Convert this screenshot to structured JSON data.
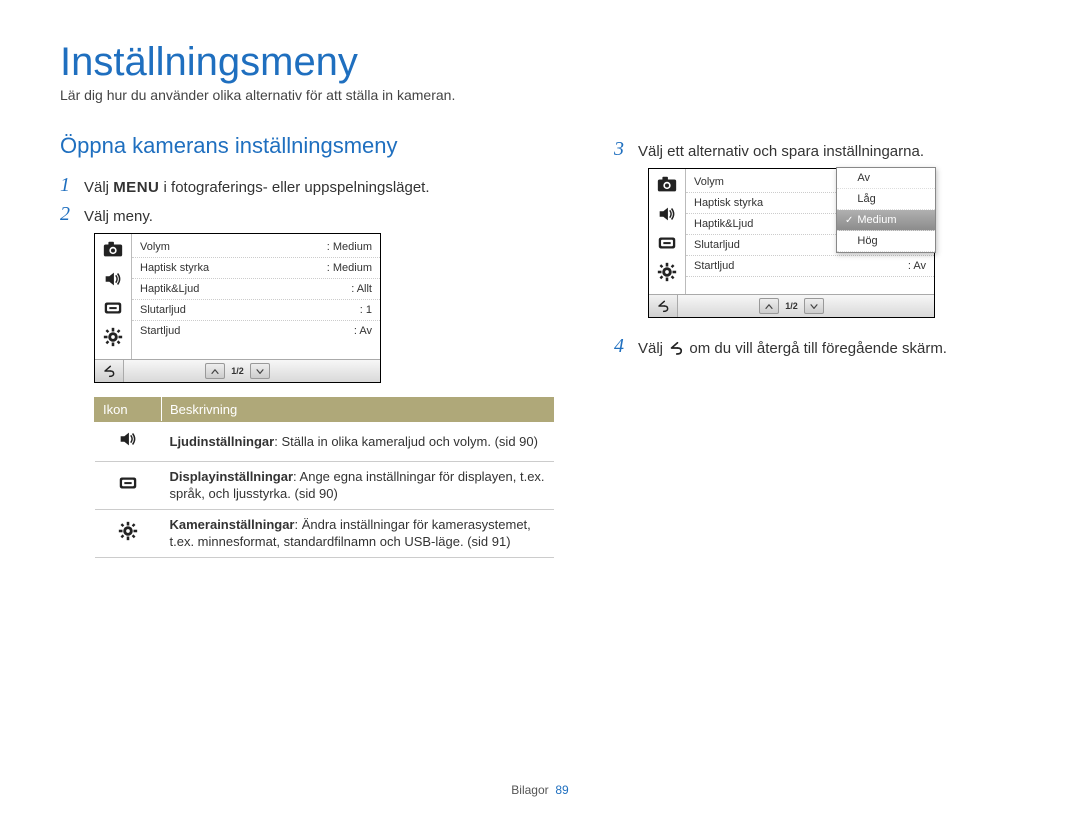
{
  "title": "Inställningsmeny",
  "subtitle": "Lär dig hur du använder olika alternativ för att ställa in kameran.",
  "section_heading": "Öppna kamerans inställningsmeny",
  "steps": {
    "s1_pre": "Välj ",
    "s1_menu": "MENU",
    "s1_post": " i fotograferings- eller uppspelningsläget.",
    "s2": "Välj meny.",
    "s3": "Välj ett alternativ och spara inställningarna.",
    "s4_pre": "Välj ",
    "s4_post": " om du vill återgå till föregående skärm."
  },
  "screen1": {
    "rows": [
      {
        "label": "Volym",
        "value": ": Medium"
      },
      {
        "label": "Haptisk styrka",
        "value": ": Medium"
      },
      {
        "label": "Haptik&Ljud",
        "value": ": Allt"
      },
      {
        "label": "Slutarljud",
        "value": ": 1"
      },
      {
        "label": "Startljud",
        "value": ": Av"
      }
    ],
    "page": "1/2"
  },
  "screen2": {
    "rows": [
      {
        "label": "Volym",
        "value": ""
      },
      {
        "label": "Haptisk styrka",
        "value": ""
      },
      {
        "label": "Haptik&Ljud",
        "value": ""
      },
      {
        "label": "Slutarljud",
        "value": ""
      },
      {
        "label": "Startljud",
        "value": ": Av"
      }
    ],
    "dropdown": {
      "options": [
        "Av",
        "Låg",
        "Medium",
        "Hög"
      ],
      "selected": "Medium"
    },
    "page": "1/2"
  },
  "table": {
    "head_icon": "Ikon",
    "head_desc": "Beskrivning",
    "rows": [
      {
        "bold": "Ljudinställningar",
        "rest": ": Ställa in olika kameraljud och volym. (sid 90)"
      },
      {
        "bold": "Displayinställningar",
        "rest": ": Ange egna inställningar för displayen, t.ex. språk, och ljusstyrka. (sid 90)"
      },
      {
        "bold": "Kamerainställningar",
        "rest": ": Ändra inställningar för kamerasystemet, t.ex. minnesformat, standardfilnamn och USB-läge. (sid 91)"
      }
    ]
  },
  "footer_label": "Bilagor",
  "footer_page": "89"
}
